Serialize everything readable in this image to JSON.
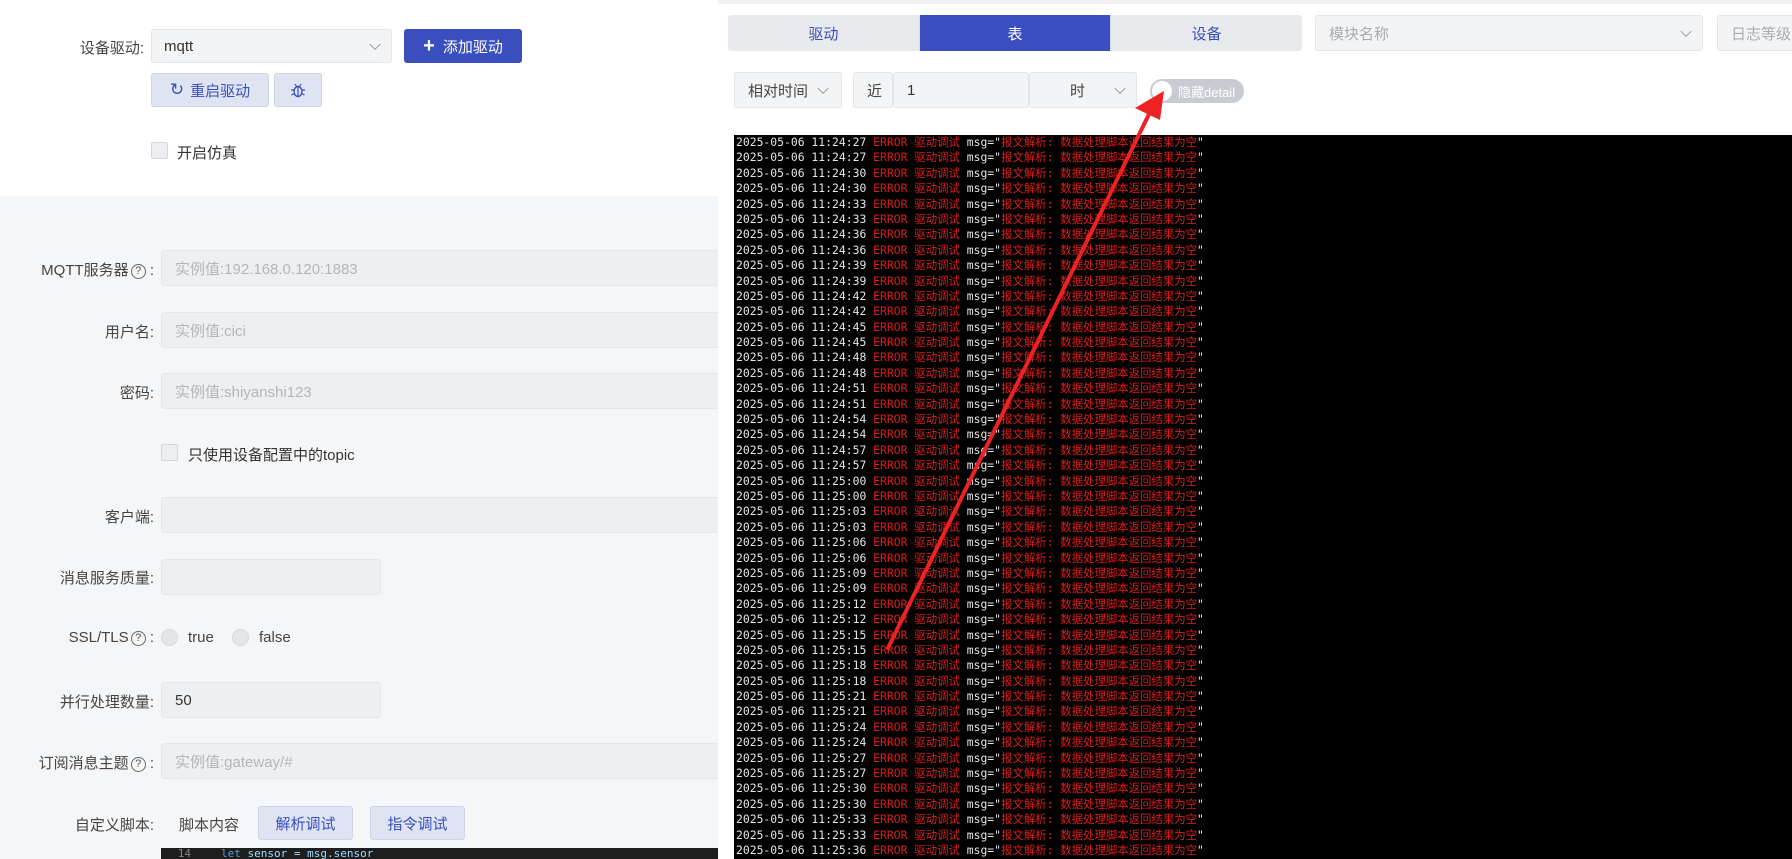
{
  "left": {
    "driver_label": "设备驱动:",
    "driver_value": "mqtt",
    "add_driver": "添加驱动",
    "restart_driver": "重启驱动",
    "simulate_label": "开启仿真",
    "mqtt_server_label": "MQTT服务器",
    "mqtt_server_placeholder": "实例值:192.168.0.120:1883",
    "username_label": "用户名:",
    "username_placeholder": "实例值:cici",
    "password_label": "密码:",
    "password_placeholder": "实例值:shiyanshi123",
    "only_device_topic": "只使用设备配置中的topic",
    "client_label": "客户端:",
    "qos_label": "消息服务质量:",
    "ssl_label": "SSL/TLS",
    "ssl_true": "true",
    "ssl_false": "false",
    "parallel_label": "并行处理数量:",
    "parallel_value": "50",
    "topic_label": "订阅消息主题",
    "topic_placeholder": "实例值:gateway/#",
    "script_label": "自定义脚本:",
    "script_content": "脚本内容",
    "parse_debug": "解析调试",
    "command_debug": "指令调试",
    "code_line_no": "14",
    "code_kw": "let",
    "code_text": " sensor = msg.sensor"
  },
  "right": {
    "tabs": [
      {
        "label": "驱动",
        "active": false
      },
      {
        "label": "表",
        "active": true
      },
      {
        "label": "设备",
        "active": false
      }
    ],
    "module_placeholder": "模块名称",
    "log_level_placeholder": "日志等级",
    "relative_time": "相对时间",
    "recent_label": "近",
    "recent_value": "1",
    "unit": "时",
    "toggle_label": "隐藏detail",
    "log_level": "ERROR",
    "log_module": "驱动调试",
    "log_msg_key": "msg=\"",
    "log_msg_text": "报文解析: 数据处理脚本返回结果为空",
    "log_msg_end": "\"",
    "log_times": [
      "2025-05-06 11:24:27",
      "2025-05-06 11:24:27",
      "2025-05-06 11:24:30",
      "2025-05-06 11:24:30",
      "2025-05-06 11:24:33",
      "2025-05-06 11:24:33",
      "2025-05-06 11:24:36",
      "2025-05-06 11:24:36",
      "2025-05-06 11:24:39",
      "2025-05-06 11:24:39",
      "2025-05-06 11:24:42",
      "2025-05-06 11:24:42",
      "2025-05-06 11:24:45",
      "2025-05-06 11:24:45",
      "2025-05-06 11:24:48",
      "2025-05-06 11:24:48",
      "2025-05-06 11:24:51",
      "2025-05-06 11:24:51",
      "2025-05-06 11:24:54",
      "2025-05-06 11:24:54",
      "2025-05-06 11:24:57",
      "2025-05-06 11:24:57",
      "2025-05-06 11:25:00",
      "2025-05-06 11:25:00",
      "2025-05-06 11:25:03",
      "2025-05-06 11:25:03",
      "2025-05-06 11:25:06",
      "2025-05-06 11:25:06",
      "2025-05-06 11:25:09",
      "2025-05-06 11:25:09",
      "2025-05-06 11:25:12",
      "2025-05-06 11:25:12",
      "2025-05-06 11:25:15",
      "2025-05-06 11:25:15",
      "2025-05-06 11:25:18",
      "2025-05-06 11:25:18",
      "2025-05-06 11:25:21",
      "2025-05-06 11:25:21",
      "2025-05-06 11:25:24",
      "2025-05-06 11:25:24",
      "2025-05-06 11:25:27",
      "2025-05-06 11:25:27",
      "2025-05-06 11:25:30",
      "2025-05-06 11:25:30",
      "2025-05-06 11:25:33",
      "2025-05-06 11:25:33",
      "2025-05-06 11:25:36"
    ]
  },
  "colors": {
    "primary": "#3a4fbd",
    "error": "#e01b1b",
    "arrow": "#ee2222"
  }
}
